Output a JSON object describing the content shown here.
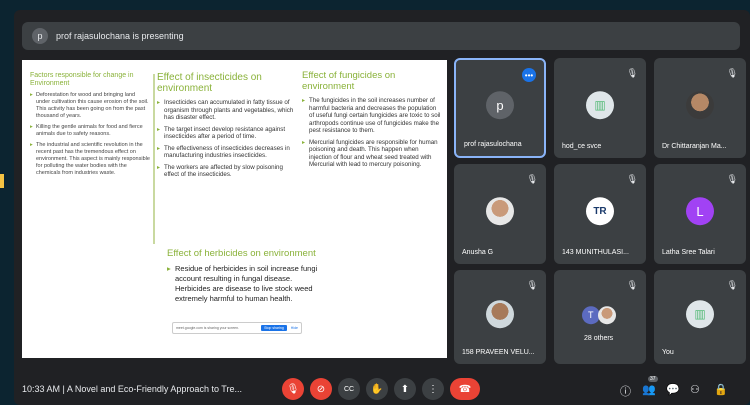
{
  "presenting_bar": {
    "avatar_letter": "p",
    "text": "prof rajasulochana is presenting"
  },
  "slide": {
    "col1_head": "Factors responsible for change in Environment",
    "col1_items": [
      "Deforestation for wood and bringing land under cultivation this cause erosion of the soil. This activity has been going on from the past thousand of years.",
      "Killing the gentle animals for food and fierce animals due to safety reasons.",
      "The industrial and scientific revolution in the recent past has the tremendous effect on environment. This aspect is mainly responsible for polluting the water bodies with the chemicals from industries waste."
    ],
    "col2_head": "Effect of insecticides on environment",
    "col2_items": [
      "Insecticides can accumulated in fatty tissue of organism through plants and vegetables, which has disaster effect.",
      "The target insect develop resistance against insecticides after a period of time.",
      "The effectiveness of insecticides decreases in manufacturing industries insecticides.",
      "The workers are affected by slow poisoning effect of the insecticides."
    ],
    "col3_head": "Effect of fungicides on environment",
    "col3_items": [
      "The fungicides in the soil increases number of harmful bacteria and decreases the population of useful fungi certain fungicides are toxic to soil arthropods continue use of fungicides make the pest resistance to them.",
      "Mercurial fungicides are responsible for human poisoning and death. This happen when injection of flour and wheat seed treated with Mercurial with lead to mercury poisoning."
    ],
    "col4_head": "Effect of herbicides on environment",
    "col4_text": "Residue of herbicides in soil increase fungi account resulting in fungal disease. Herbicides are disease to live stock weed extremely harmful to human health.",
    "popup_text": "meet.google.com is sharing your screen.",
    "popup_btn": "Stop sharing",
    "popup_btn2": "Hide"
  },
  "tiles": [
    {
      "name": "prof rajasulochana",
      "initial": "p",
      "active": true,
      "more": "•••"
    },
    {
      "name": "hod_ce svce",
      "initial": "",
      "mute": "🎙"
    },
    {
      "name": "Dr Chittaranjan Ma...",
      "initial": "",
      "mute": "🎙"
    },
    {
      "name": "Anusha G",
      "initial": "",
      "mute": "🎙"
    },
    {
      "name": "143 MUNITHULASI...",
      "initial": "TR",
      "mute": "🎙"
    },
    {
      "name": "Latha Sree Talari",
      "initial": "L",
      "mute": "🎙"
    },
    {
      "name": "158 PRAVEEN VELU...",
      "initial": "",
      "mute": "🎙"
    },
    {
      "name": "28 others",
      "initial": "T",
      "mute": "🎙"
    },
    {
      "name": "You",
      "initial": "",
      "mute": "🎙"
    }
  ],
  "bottom": {
    "time_title": "10:33 AM  |  A Novel and Eco-Friendly Approach to Tre...",
    "icons": {
      "mic": "🎙",
      "cam": "⊘",
      "cc": "CC",
      "hand": "✋",
      "present": "⬆",
      "more": "⋮",
      "end": "☎",
      "info": "ⓘ",
      "people": "👥",
      "chat": "💬",
      "activities": "⚇",
      "lock": "🔒"
    },
    "people_count": "37"
  },
  "colors": {
    "accent": "#1a73e8",
    "end_call": "#ea4335",
    "slide_green": "#8ab23a"
  }
}
